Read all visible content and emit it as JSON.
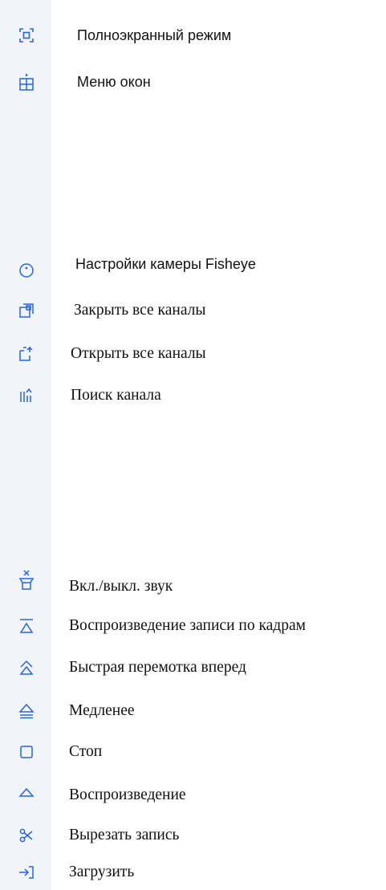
{
  "colors": {
    "icon": "#2563eb",
    "rail": "#f1f4f8",
    "text": "#111111"
  },
  "items": [
    {
      "label": "Полноэкранный режим",
      "icon": "fullscreen-icon"
    },
    {
      "label": "Меню окон",
      "icon": "window-grid-icon"
    },
    {
      "label": "Настройки камеры Fisheye",
      "icon": "fisheye-icon"
    },
    {
      "label": "Закрыть все каналы",
      "icon": "close-channels-icon"
    },
    {
      "label": "Открыть все каналы",
      "icon": "open-channels-icon"
    },
    {
      "label": "Поиск канала",
      "icon": "channel-search-icon"
    },
    {
      "label": "Вкл./выкл. звук",
      "icon": "audio-toggle-icon"
    },
    {
      "label": "Воспроизведение записи по кадрам",
      "icon": "frame-playback-icon"
    },
    {
      "label": "Быстрая перемотка вперед",
      "icon": "fast-forward-icon"
    },
    {
      "label": "Медленее",
      "icon": "slow-icon"
    },
    {
      "label": "Стоп",
      "icon": "stop-icon"
    },
    {
      "label": "Воспроизведение",
      "icon": "play-icon"
    },
    {
      "label": "Вырезать запись",
      "icon": "cut-record-icon"
    },
    {
      "label": "Загрузить",
      "icon": "download-icon"
    }
  ]
}
